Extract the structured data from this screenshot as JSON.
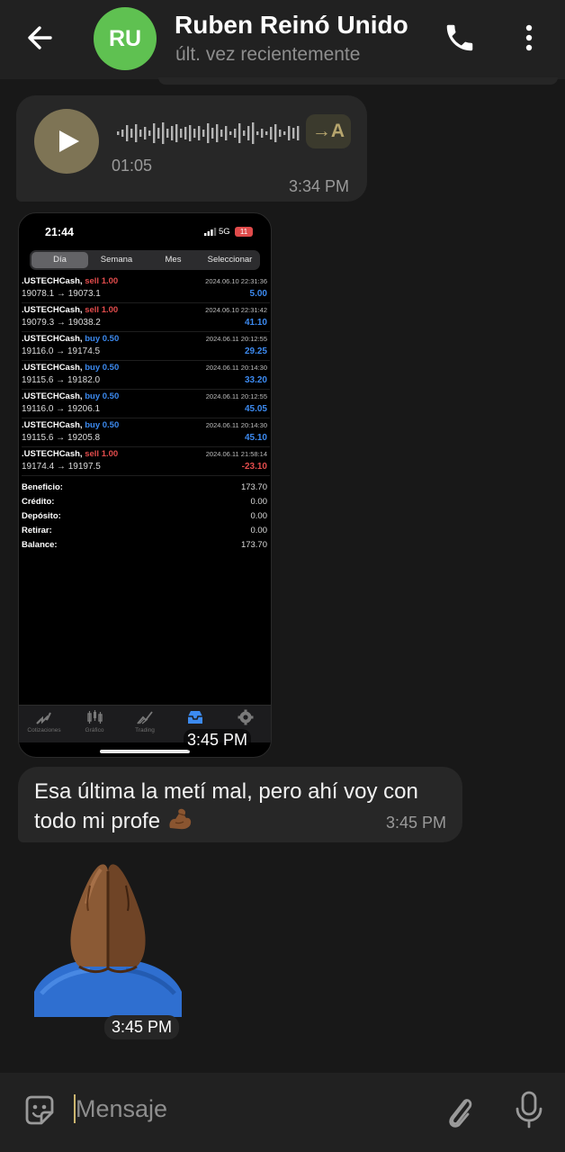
{
  "header": {
    "avatar_initials": "RU",
    "contact_name": "Ruben Reinó Unido",
    "status": "últ. vez recientemente",
    "avatar_color": "#5fc151"
  },
  "messages": {
    "voice": {
      "duration": "01:05",
      "time": "3:34 PM",
      "transcribe_label": "→A"
    },
    "image": {
      "time": "3:45 PM",
      "phone": {
        "clock": "21:44",
        "network": "5G",
        "battery": "11",
        "segments": [
          "Día",
          "Semana",
          "Mes",
          "Seleccionar"
        ],
        "deals": [
          {
            "symbol": ".USTECHCash,",
            "side": "sell 1.00",
            "side_type": "sell",
            "date": "2024.06.10 22:31:36",
            "open": "19078.1",
            "close": "19073.1",
            "profit": "5.00",
            "profit_type": "pos"
          },
          {
            "symbol": ".USTECHCash,",
            "side": "sell 1.00",
            "side_type": "sell",
            "date": "2024.06.10 22:31:42",
            "open": "19079.3",
            "close": "19038.2",
            "profit": "41.10",
            "profit_type": "pos"
          },
          {
            "symbol": ".USTECHCash,",
            "side": "buy 0.50",
            "side_type": "buy",
            "date": "2024.06.11 20:12:55",
            "open": "19116.0",
            "close": "19174.5",
            "profit": "29.25",
            "profit_type": "pos"
          },
          {
            "symbol": ".USTECHCash,",
            "side": "buy 0.50",
            "side_type": "buy",
            "date": "2024.06.11 20:14:30",
            "open": "19115.6",
            "close": "19182.0",
            "profit": "33.20",
            "profit_type": "pos"
          },
          {
            "symbol": ".USTECHCash,",
            "side": "buy 0.50",
            "side_type": "buy",
            "date": "2024.06.11 20:12:55",
            "open": "19116.0",
            "close": "19206.1",
            "profit": "45.05",
            "profit_type": "pos"
          },
          {
            "symbol": ".USTECHCash,",
            "side": "buy 0.50",
            "side_type": "buy",
            "date": "2024.06.11 20:14:30",
            "open": "19115.6",
            "close": "19205.8",
            "profit": "45.10",
            "profit_type": "pos"
          },
          {
            "symbol": ".USTECHCash,",
            "side": "sell 1.00",
            "side_type": "sell",
            "date": "2024.06.11 21:58:14",
            "open": "19174.4",
            "close": "19197.5",
            "profit": "-23.10",
            "profit_type": "neg"
          }
        ],
        "summary": [
          {
            "label": "Beneficio:",
            "value": "173.70"
          },
          {
            "label": "Crédito:",
            "value": "0.00"
          },
          {
            "label": "Depósito:",
            "value": "0.00"
          },
          {
            "label": "Retirar:",
            "value": "0.00"
          },
          {
            "label": "Balance:",
            "value": "173.70"
          }
        ],
        "tabs": [
          "Cotizaciones",
          "Gráfico",
          "Trading",
          "",
          ""
        ]
      }
    },
    "text": {
      "body": "Esa última la metí mal, pero ahí voy con todo mi profe",
      "time": "3:45 PM"
    },
    "emoji": {
      "icon": "folded-hands-emoji",
      "time": "3:45 PM"
    }
  },
  "input": {
    "placeholder": "Mensaje"
  },
  "colors": {
    "bubble": "#272727",
    "background": "#181818",
    "accent_gold": "#cbb56f",
    "sell": "#e24c4c",
    "buy": "#3c8af0"
  }
}
